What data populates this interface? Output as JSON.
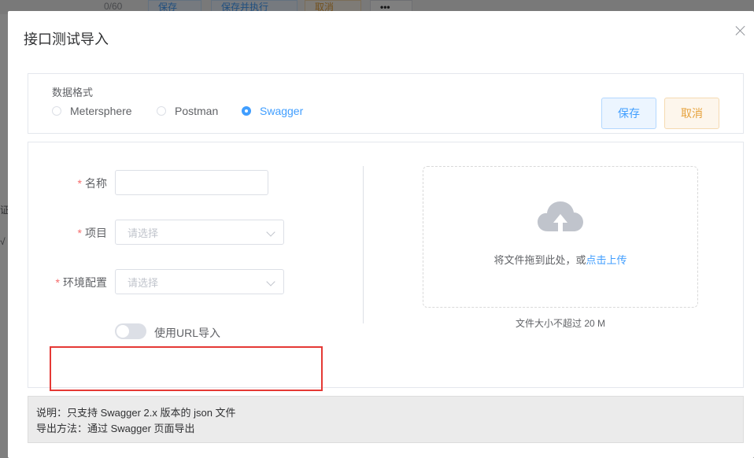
{
  "background": {
    "counter": "0/60",
    "buttons": [
      "保存",
      "保存并执行",
      "取消",
      "•••"
    ],
    "left_fragments": [
      "证",
      "√"
    ]
  },
  "dialog": {
    "title": "接口测试导入",
    "format": {
      "label": "数据格式",
      "options": [
        "Metersphere",
        "Postman",
        "Swagger"
      ],
      "selected": "Swagger"
    },
    "actions": {
      "save_label": "保存",
      "cancel_label": "取消"
    },
    "form": {
      "name": {
        "label": "名称",
        "value": ""
      },
      "project": {
        "label": "项目",
        "placeholder": "请选择"
      },
      "env": {
        "label": "环境配置",
        "placeholder": "请选择"
      },
      "url_import": {
        "label": "使用URL导入",
        "enabled": false
      }
    },
    "upload": {
      "text": "将文件拖到此处，或",
      "link": "点击上传",
      "tip": "文件大小不超过 20 M",
      "icon": "cloud-upload-icon"
    },
    "note": {
      "line1": "说明：只支持 Swagger 2.x 版本的 json 文件",
      "line2": "导出方法：通过 Swagger 页面导出"
    }
  },
  "colors": {
    "primary": "#409eff",
    "warning": "#e6a23c",
    "danger": "#f56c6c",
    "highlight_box": "#e53935"
  }
}
